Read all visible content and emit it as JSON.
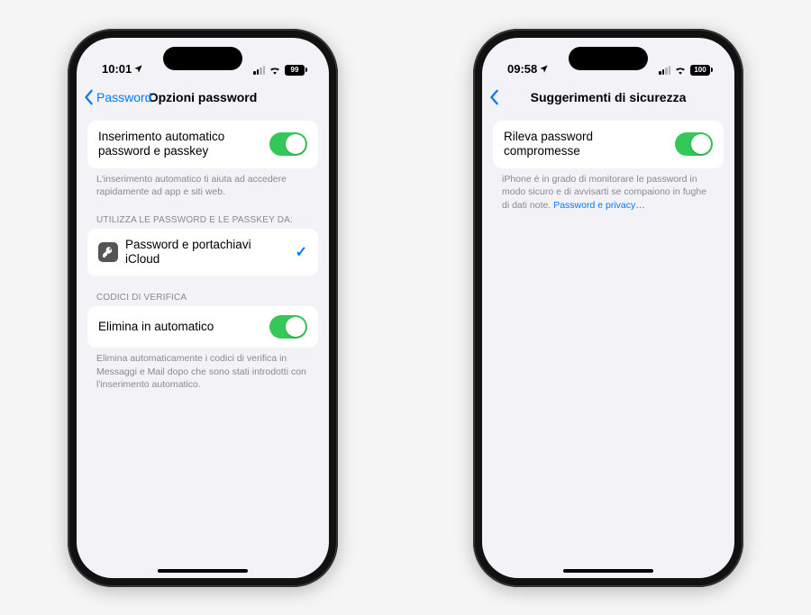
{
  "left": {
    "status": {
      "time": "10:01",
      "battery": "99"
    },
    "nav": {
      "back": "Password",
      "title": "Opzioni password"
    },
    "group1": {
      "label": "Inserimento automatico password e passkey",
      "footer": "L'inserimento automatico ti aiuta ad accedere rapidamente ad app e siti web."
    },
    "group2": {
      "header": "UTILIZZA LE PASSWORD E LE PASSKEY DA:",
      "item": "Password e portachiavi iCloud"
    },
    "group3": {
      "header": "CODICI DI VERIFICA",
      "label": "Elimina in automatico",
      "footer": "Elimina automaticamente i codici di verifica in Messaggi e Mail dopo che sono stati introdotti con l'inserimento automatico."
    }
  },
  "right": {
    "status": {
      "time": "09:58",
      "battery": "100"
    },
    "nav": {
      "title": "Suggerimenti di sicurezza"
    },
    "group1": {
      "label": "Rileva password compromesse",
      "footer": "iPhone è in grado di monitorare le password in modo sicuro e di avvisarti se compaiono in fughe di dati note.",
      "link": "Password e privacy…"
    }
  }
}
